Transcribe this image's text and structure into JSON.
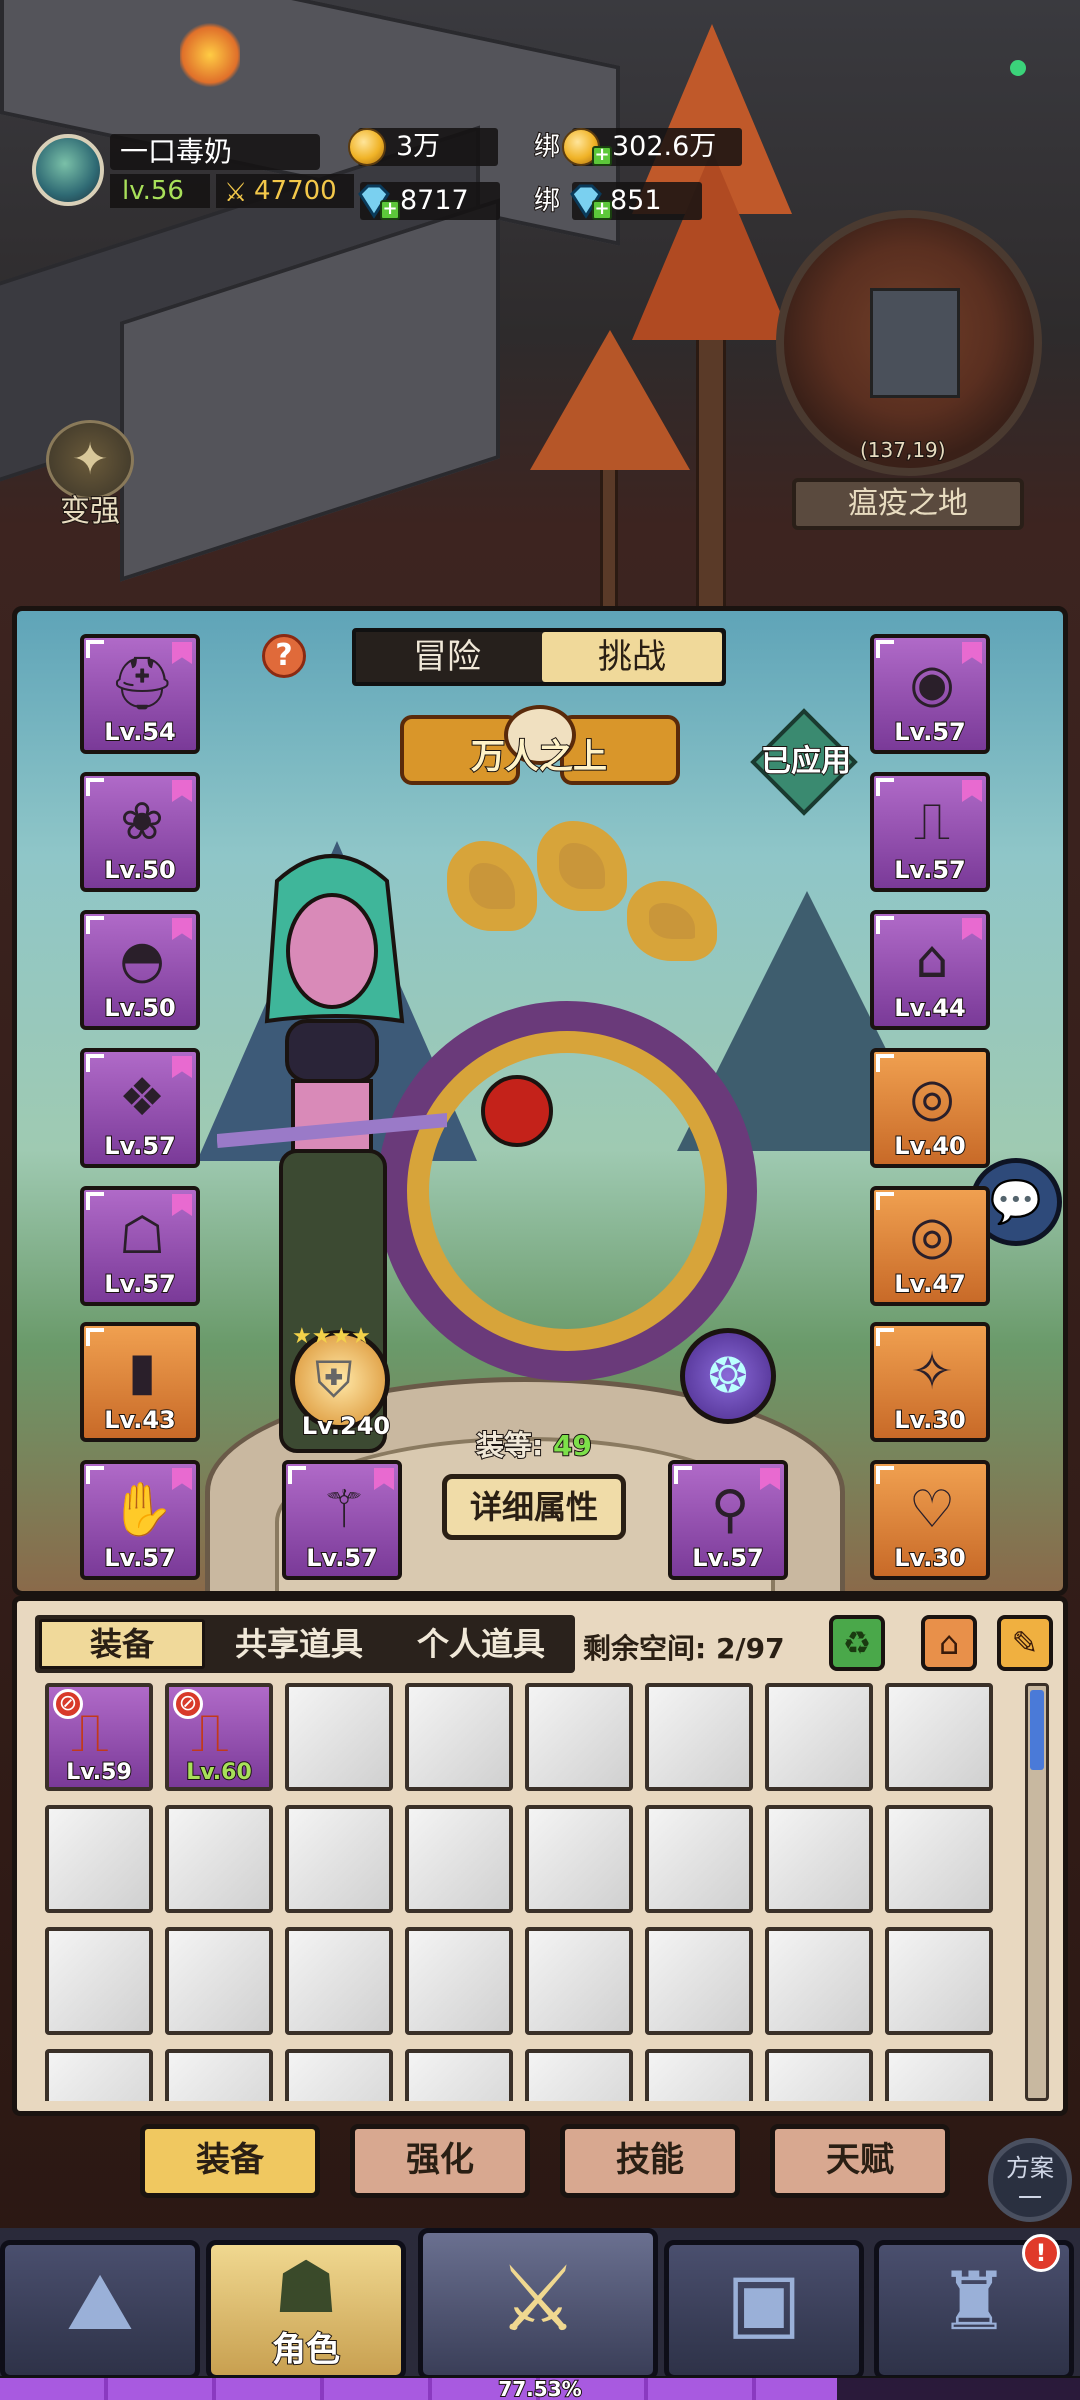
{
  "player": {
    "name": "一口毒奶",
    "level": "lv.56",
    "power": "47700"
  },
  "resources": {
    "gold": "3万",
    "bound_gold_prefix": "绑",
    "bound_gold": "302.6万",
    "diamonds": "8717",
    "bound_diamond_prefix": "绑",
    "bound_diamonds": "851"
  },
  "map": {
    "strengthen_label": "变强",
    "coords": "(137,19)",
    "zone_name": "瘟疫之地"
  },
  "hero_panel": {
    "tabs": [
      {
        "label": "冒险",
        "active": false
      },
      {
        "label": "挑战",
        "active": true
      }
    ],
    "help_icon": "?",
    "title_badge": "万人之上",
    "applied_label": "已应用",
    "main_gear_level": "Lv.240",
    "main_gear_stars": "★★★★",
    "gear_score_label": "装等:",
    "gear_score": "49",
    "detail_button": "详细属性",
    "left_slots": [
      {
        "level": "Lv.54",
        "rarity": "purple",
        "icon": "helmet-icon"
      },
      {
        "level": "Lv.50",
        "rarity": "purple",
        "icon": "amulet-icon"
      },
      {
        "level": "Lv.50",
        "rarity": "purple",
        "icon": "shoulder-icon"
      },
      {
        "level": "Lv.57",
        "rarity": "purple",
        "icon": "cape-icon"
      },
      {
        "level": "Lv.57",
        "rarity": "purple",
        "icon": "robe-icon"
      },
      {
        "level": "Lv.43",
        "rarity": "orange",
        "icon": "bracer-icon"
      },
      {
        "level": "Lv.57",
        "rarity": "purple",
        "icon": "gauntlet-icon"
      }
    ],
    "right_slots": [
      {
        "level": "Lv.57",
        "rarity": "purple",
        "icon": "belt-icon"
      },
      {
        "level": "Lv.57",
        "rarity": "purple",
        "icon": "pants-icon"
      },
      {
        "level": "Lv.44",
        "rarity": "purple",
        "icon": "boots-icon"
      },
      {
        "level": "Lv.40",
        "rarity": "orange",
        "icon": "ring-icon"
      },
      {
        "level": "Lv.47",
        "rarity": "orange",
        "icon": "ring-icon"
      },
      {
        "level": "Lv.30",
        "rarity": "orange",
        "icon": "trinket-icon"
      },
      {
        "level": "Lv.30",
        "rarity": "orange",
        "icon": "necklace-icon"
      }
    ],
    "weapon_slots": [
      {
        "level": "Lv.57",
        "icon": "staff-icon"
      },
      {
        "level": "Lv.57",
        "icon": "wand-icon"
      }
    ]
  },
  "inventory": {
    "tabs": [
      {
        "label": "装备",
        "active": true
      },
      {
        "label": "共享道具",
        "active": false
      },
      {
        "label": "个人道具",
        "active": false
      }
    ],
    "space_label": "剩余空间: 2/97",
    "items": [
      {
        "level": "Lv.59",
        "icon": "pants-icon",
        "banned": true,
        "level_color": "#ffffff"
      },
      {
        "level": "Lv.60",
        "icon": "pants-icon",
        "banned": true,
        "level_color": "#a8e05a"
      }
    ]
  },
  "sub_tabs": [
    "装备",
    "强化",
    "技能",
    "天赋"
  ],
  "plan_button": "方案一",
  "nav": {
    "role_label": "角色",
    "xp_percent": 77.53,
    "xp_text": "77.53%",
    "badge": "!"
  },
  "colors": {
    "purple_rarity": "#9a52b8",
    "orange_rarity": "#e08a3a",
    "accent_gold": "#f0d99a",
    "gear_score_green": "#7de04a"
  }
}
